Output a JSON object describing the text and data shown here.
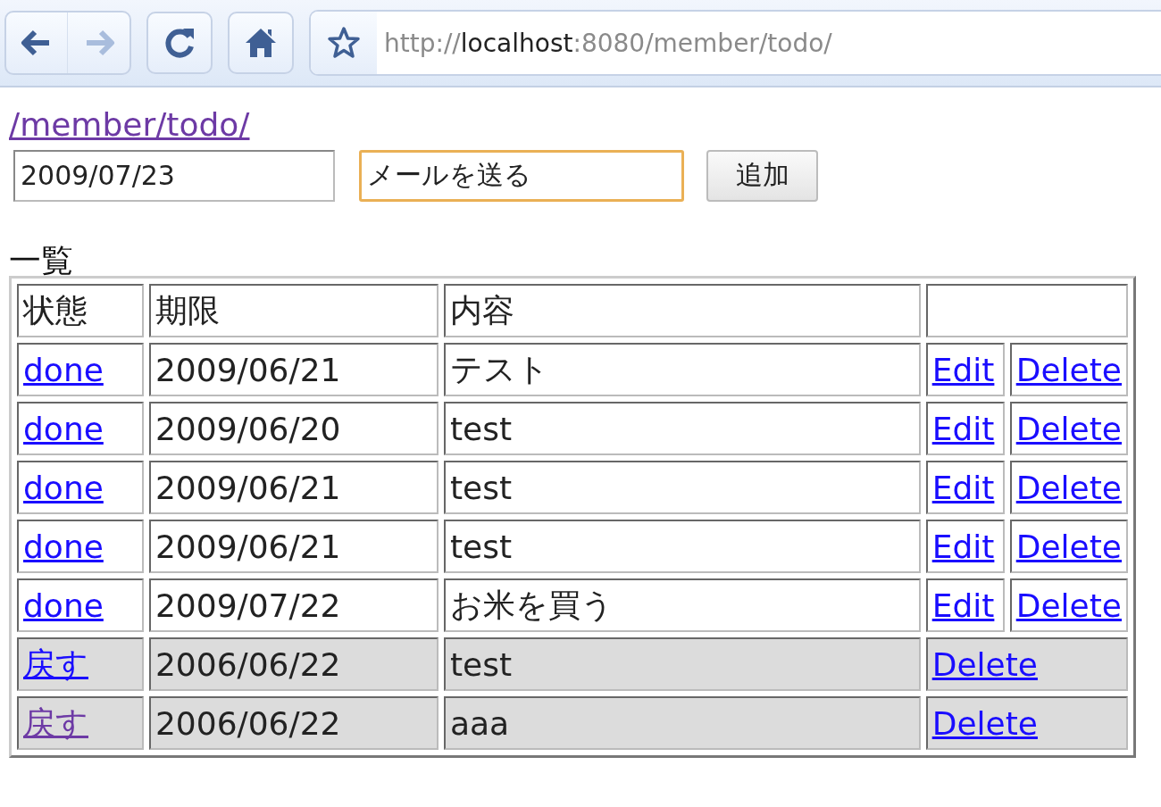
{
  "toolbar": {
    "back": {
      "disabled": false
    },
    "forward": {
      "disabled": true
    },
    "url": {
      "scheme": "http://",
      "host": "localhost",
      "rest": ":8080/member/todo/"
    }
  },
  "page_link": {
    "label": "/member/todo/",
    "visited": true
  },
  "form": {
    "date_value": "2009/07/23",
    "text_value": "メールを送る",
    "text_focused": true,
    "add_button": "追加"
  },
  "list_heading": "一覧",
  "table": {
    "columns": [
      "状態",
      "期限",
      "内容"
    ],
    "rows": [
      {
        "kind": "open",
        "status": "done",
        "status_visited": false,
        "due": "2009/06/21",
        "content": "テスト",
        "edit": "Edit",
        "delete": "Delete"
      },
      {
        "kind": "open",
        "status": "done",
        "status_visited": false,
        "due": "2009/06/20",
        "content": "test",
        "edit": "Edit",
        "delete": "Delete"
      },
      {
        "kind": "open",
        "status": "done",
        "status_visited": false,
        "due": "2009/06/21",
        "content": "test",
        "edit": "Edit",
        "delete": "Delete"
      },
      {
        "kind": "open",
        "status": "done",
        "status_visited": false,
        "due": "2009/06/21",
        "content": "test",
        "edit": "Edit",
        "delete": "Delete"
      },
      {
        "kind": "open",
        "status": "done",
        "status_visited": false,
        "due": "2009/07/22",
        "content": "お米を買う",
        "edit": "Edit",
        "delete": "Delete"
      },
      {
        "kind": "finished",
        "status": "戻す",
        "status_visited": false,
        "due": "2006/06/22",
        "content": "test",
        "delete": "Delete"
      },
      {
        "kind": "finished",
        "status": "戻す",
        "status_visited": true,
        "due": "2006/06/22",
        "content": "aaa",
        "delete": "Delete"
      }
    ]
  }
}
